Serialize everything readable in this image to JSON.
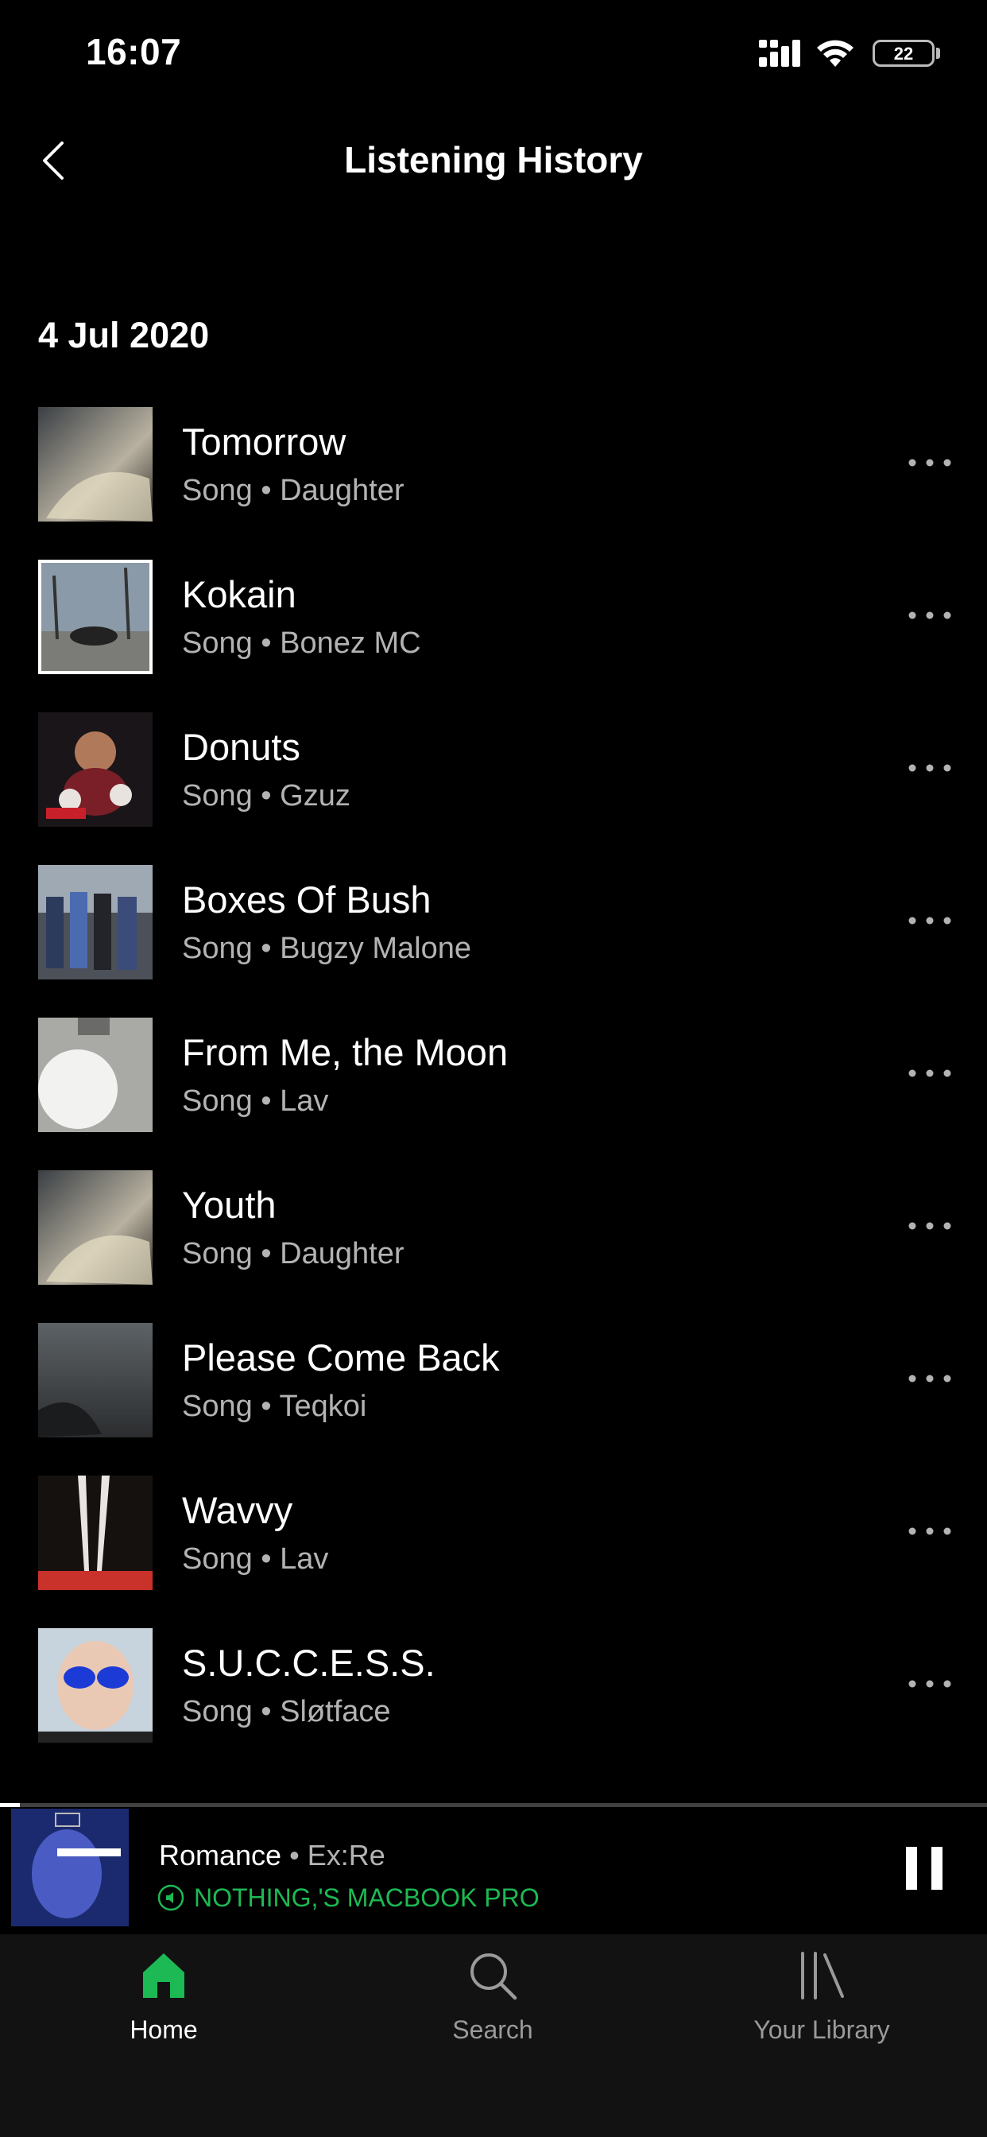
{
  "status_bar": {
    "time": "16:07",
    "battery": "22"
  },
  "header": {
    "title": "Listening History"
  },
  "section": {
    "date": "4 Jul 2020"
  },
  "tracks": [
    {
      "title": "Tomorrow",
      "subtitle": "Song • Daughter"
    },
    {
      "title": "Kokain",
      "subtitle": "Song • Bonez MC"
    },
    {
      "title": "Donuts",
      "subtitle": "Song • Gzuz"
    },
    {
      "title": "Boxes Of Bush",
      "subtitle": "Song • Bugzy Malone"
    },
    {
      "title": "From Me, the Moon",
      "subtitle": "Song • Lav"
    },
    {
      "title": "Youth",
      "subtitle": "Song • Daughter"
    },
    {
      "title": "Please Come Back",
      "subtitle": "Song • Teqkoi"
    },
    {
      "title": "Wavvy",
      "subtitle": "Song • Lav"
    },
    {
      "title": "S.U.C.C.E.S.S.",
      "subtitle": "Song • Sløtface"
    }
  ],
  "now_playing": {
    "track": "Romance",
    "separator": " • ",
    "artist": "Ex:Re",
    "device": "NOTHING,'S MACBOOK PRO",
    "progress": 0.02
  },
  "tab_bar": {
    "home": "Home",
    "search": "Search",
    "library": "Your Library"
  },
  "colors": {
    "accent": "#1db954",
    "background": "#000000",
    "secondary_text": "#b3b3b3"
  }
}
